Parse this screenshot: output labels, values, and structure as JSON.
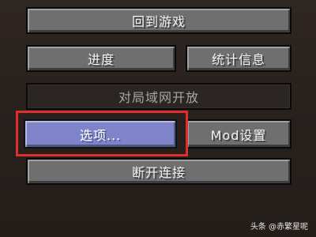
{
  "menu": {
    "back_to_game": "回到游戏",
    "advancements": "进度",
    "statistics": "统计信息",
    "open_to_lan": "对局域网开放",
    "options": "选项...",
    "mod_settings": "Mod设置",
    "disconnect": "断开连接"
  },
  "watermark": {
    "text": "头条 @赤繁星呢"
  },
  "colors": {
    "highlight": "#e22d2d",
    "selected_button": "#7f84c8"
  }
}
